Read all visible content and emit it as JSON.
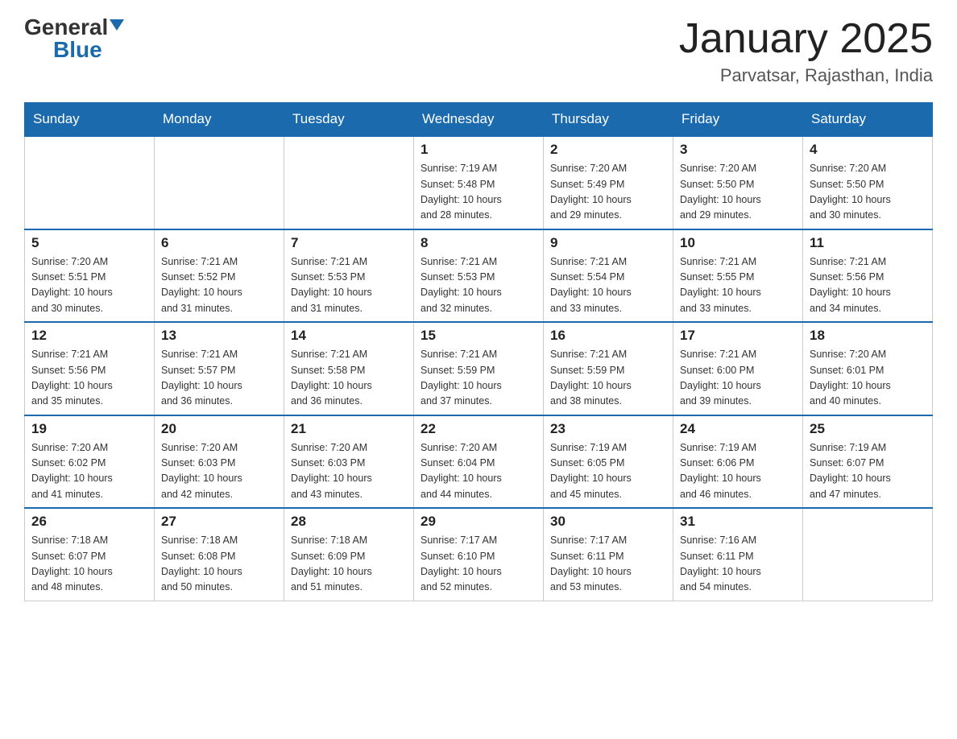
{
  "header": {
    "logo_general": "General",
    "logo_blue": "Blue",
    "title": "January 2025",
    "subtitle": "Parvatsar, Rajasthan, India"
  },
  "days_of_week": [
    "Sunday",
    "Monday",
    "Tuesday",
    "Wednesday",
    "Thursday",
    "Friday",
    "Saturday"
  ],
  "weeks": [
    [
      {
        "day": "",
        "info": ""
      },
      {
        "day": "",
        "info": ""
      },
      {
        "day": "",
        "info": ""
      },
      {
        "day": "1",
        "info": "Sunrise: 7:19 AM\nSunset: 5:48 PM\nDaylight: 10 hours\nand 28 minutes."
      },
      {
        "day": "2",
        "info": "Sunrise: 7:20 AM\nSunset: 5:49 PM\nDaylight: 10 hours\nand 29 minutes."
      },
      {
        "day": "3",
        "info": "Sunrise: 7:20 AM\nSunset: 5:50 PM\nDaylight: 10 hours\nand 29 minutes."
      },
      {
        "day": "4",
        "info": "Sunrise: 7:20 AM\nSunset: 5:50 PM\nDaylight: 10 hours\nand 30 minutes."
      }
    ],
    [
      {
        "day": "5",
        "info": "Sunrise: 7:20 AM\nSunset: 5:51 PM\nDaylight: 10 hours\nand 30 minutes."
      },
      {
        "day": "6",
        "info": "Sunrise: 7:21 AM\nSunset: 5:52 PM\nDaylight: 10 hours\nand 31 minutes."
      },
      {
        "day": "7",
        "info": "Sunrise: 7:21 AM\nSunset: 5:53 PM\nDaylight: 10 hours\nand 31 minutes."
      },
      {
        "day": "8",
        "info": "Sunrise: 7:21 AM\nSunset: 5:53 PM\nDaylight: 10 hours\nand 32 minutes."
      },
      {
        "day": "9",
        "info": "Sunrise: 7:21 AM\nSunset: 5:54 PM\nDaylight: 10 hours\nand 33 minutes."
      },
      {
        "day": "10",
        "info": "Sunrise: 7:21 AM\nSunset: 5:55 PM\nDaylight: 10 hours\nand 33 minutes."
      },
      {
        "day": "11",
        "info": "Sunrise: 7:21 AM\nSunset: 5:56 PM\nDaylight: 10 hours\nand 34 minutes."
      }
    ],
    [
      {
        "day": "12",
        "info": "Sunrise: 7:21 AM\nSunset: 5:56 PM\nDaylight: 10 hours\nand 35 minutes."
      },
      {
        "day": "13",
        "info": "Sunrise: 7:21 AM\nSunset: 5:57 PM\nDaylight: 10 hours\nand 36 minutes."
      },
      {
        "day": "14",
        "info": "Sunrise: 7:21 AM\nSunset: 5:58 PM\nDaylight: 10 hours\nand 36 minutes."
      },
      {
        "day": "15",
        "info": "Sunrise: 7:21 AM\nSunset: 5:59 PM\nDaylight: 10 hours\nand 37 minutes."
      },
      {
        "day": "16",
        "info": "Sunrise: 7:21 AM\nSunset: 5:59 PM\nDaylight: 10 hours\nand 38 minutes."
      },
      {
        "day": "17",
        "info": "Sunrise: 7:21 AM\nSunset: 6:00 PM\nDaylight: 10 hours\nand 39 minutes."
      },
      {
        "day": "18",
        "info": "Sunrise: 7:20 AM\nSunset: 6:01 PM\nDaylight: 10 hours\nand 40 minutes."
      }
    ],
    [
      {
        "day": "19",
        "info": "Sunrise: 7:20 AM\nSunset: 6:02 PM\nDaylight: 10 hours\nand 41 minutes."
      },
      {
        "day": "20",
        "info": "Sunrise: 7:20 AM\nSunset: 6:03 PM\nDaylight: 10 hours\nand 42 minutes."
      },
      {
        "day": "21",
        "info": "Sunrise: 7:20 AM\nSunset: 6:03 PM\nDaylight: 10 hours\nand 43 minutes."
      },
      {
        "day": "22",
        "info": "Sunrise: 7:20 AM\nSunset: 6:04 PM\nDaylight: 10 hours\nand 44 minutes."
      },
      {
        "day": "23",
        "info": "Sunrise: 7:19 AM\nSunset: 6:05 PM\nDaylight: 10 hours\nand 45 minutes."
      },
      {
        "day": "24",
        "info": "Sunrise: 7:19 AM\nSunset: 6:06 PM\nDaylight: 10 hours\nand 46 minutes."
      },
      {
        "day": "25",
        "info": "Sunrise: 7:19 AM\nSunset: 6:07 PM\nDaylight: 10 hours\nand 47 minutes."
      }
    ],
    [
      {
        "day": "26",
        "info": "Sunrise: 7:18 AM\nSunset: 6:07 PM\nDaylight: 10 hours\nand 48 minutes."
      },
      {
        "day": "27",
        "info": "Sunrise: 7:18 AM\nSunset: 6:08 PM\nDaylight: 10 hours\nand 50 minutes."
      },
      {
        "day": "28",
        "info": "Sunrise: 7:18 AM\nSunset: 6:09 PM\nDaylight: 10 hours\nand 51 minutes."
      },
      {
        "day": "29",
        "info": "Sunrise: 7:17 AM\nSunset: 6:10 PM\nDaylight: 10 hours\nand 52 minutes."
      },
      {
        "day": "30",
        "info": "Sunrise: 7:17 AM\nSunset: 6:11 PM\nDaylight: 10 hours\nand 53 minutes."
      },
      {
        "day": "31",
        "info": "Sunrise: 7:16 AM\nSunset: 6:11 PM\nDaylight: 10 hours\nand 54 minutes."
      },
      {
        "day": "",
        "info": ""
      }
    ]
  ]
}
